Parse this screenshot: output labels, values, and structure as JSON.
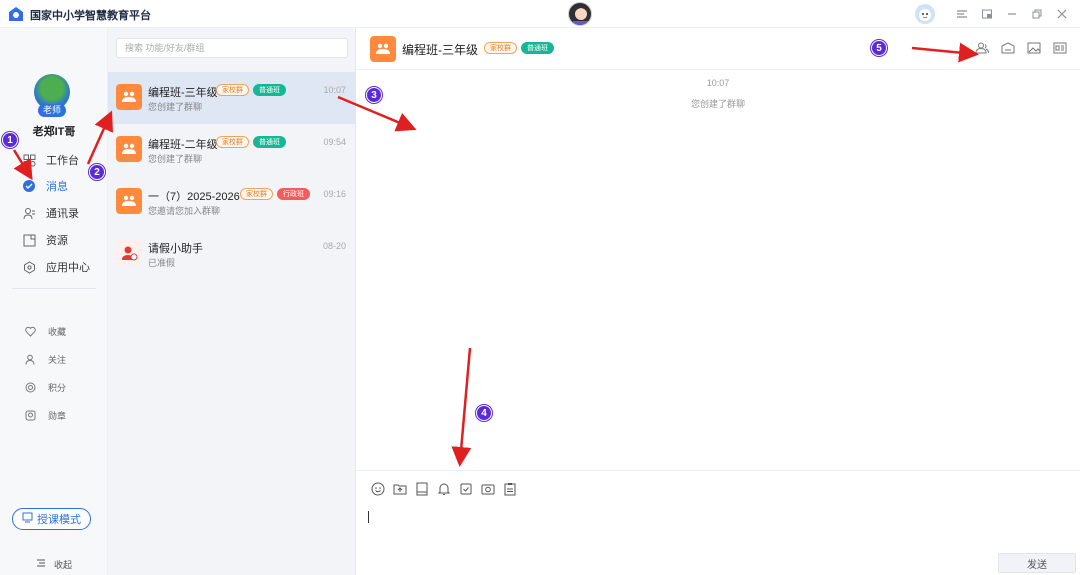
{
  "app": {
    "title": "国家中小学智慧教育平台",
    "window_buttons": [
      "menu-icon",
      "minimize-to-tray-icon",
      "minimize-icon",
      "restore-icon",
      "close-icon"
    ]
  },
  "nav": {
    "user_name": "老郑IT哥",
    "role_badge": "老师",
    "items": [
      {
        "label": "工作台",
        "icon": "grid-icon",
        "active": false
      },
      {
        "label": "消息",
        "icon": "message-icon",
        "active": true
      },
      {
        "label": "通讯录",
        "icon": "contacts-icon",
        "active": false
      },
      {
        "label": "资源",
        "icon": "resource-icon",
        "active": false
      },
      {
        "label": "应用中心",
        "icon": "app-center-icon",
        "active": false
      }
    ],
    "small_items": [
      {
        "label": "收藏",
        "icon": "heart-icon"
      },
      {
        "label": "关注",
        "icon": "follow-icon"
      },
      {
        "label": "积分",
        "icon": "points-icon"
      },
      {
        "label": "勋章",
        "icon": "medal-icon"
      }
    ],
    "mode_button": "授课模式",
    "collapse_label": "收起"
  },
  "sessions": {
    "search_placeholder": "搜索 功能/好友/群组",
    "items": [
      {
        "name": "编程班-三年级",
        "tags": [
          {
            "text": "家校群",
            "kind": "school"
          },
          {
            "text": "普通班",
            "kind": "normal"
          }
        ],
        "sub": "您创建了群聊",
        "time": "10:07",
        "active": true
      },
      {
        "name": "编程班-二年级",
        "tags": [
          {
            "text": "家校群",
            "kind": "school"
          },
          {
            "text": "普通班",
            "kind": "normal"
          }
        ],
        "sub": "您创建了群聊",
        "time": "09:54",
        "active": false
      },
      {
        "name": "一（7）2025-2026",
        "tags": [
          {
            "text": "家校群",
            "kind": "school"
          },
          {
            "text": "行政班",
            "kind": "admin"
          }
        ],
        "sub": "您邀请您加入群聊",
        "time": "09:16",
        "active": false
      },
      {
        "name": "请假小助手",
        "tags": [],
        "sub": "已准假",
        "time": "08-20",
        "active": false
      }
    ]
  },
  "chat": {
    "title": "编程班-三年级",
    "tags": [
      {
        "text": "家校群",
        "kind": "school"
      },
      {
        "text": "普通班",
        "kind": "normal"
      }
    ],
    "header_icons": [
      "group-members-icon",
      "homework-icon",
      "album-icon",
      "class-card-icon"
    ],
    "messages": {
      "time": "10:07",
      "system": "您创建了群聊"
    },
    "toolbar_icons": [
      "emoji-icon",
      "file-upload-icon",
      "notebook-icon",
      "bell-icon",
      "checkin-icon",
      "camera-icon",
      "clipboard-icon"
    ],
    "send_label": "发送"
  },
  "annotations": [
    "1",
    "2",
    "3",
    "4",
    "5"
  ],
  "colors": {
    "accent": "#2f6fdf",
    "annotation": "#5b2bd6",
    "arrow": "#e02020",
    "group_orange": "#ff8a3d"
  }
}
